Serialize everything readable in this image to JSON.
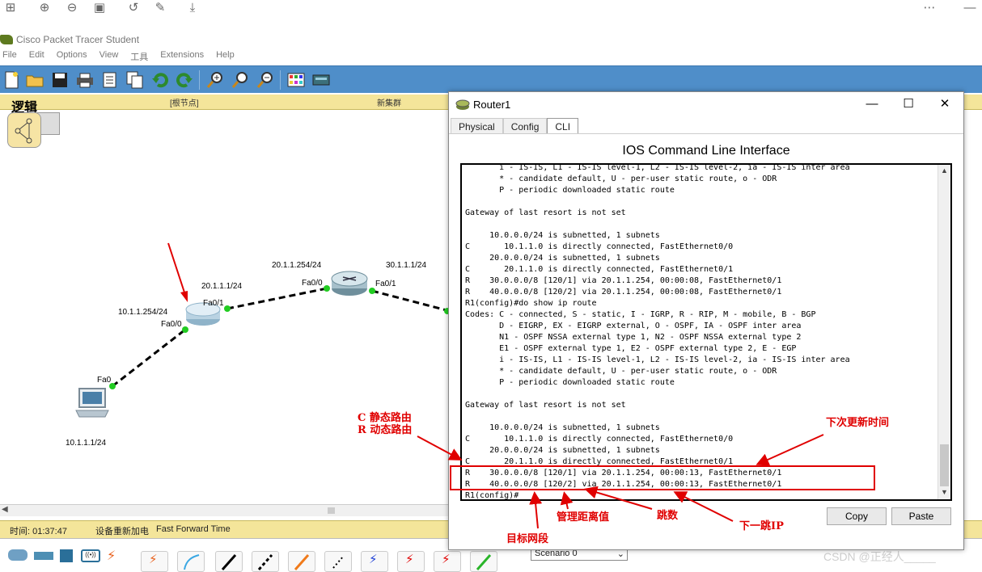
{
  "app": {
    "title": "Cisco Packet Tracer Student",
    "menu": [
      "File",
      "Edit",
      "Options",
      "View",
      "工具",
      "Extensions",
      "Help"
    ]
  },
  "logical": {
    "label": "逻辑",
    "root_node": "[根节点]",
    "new_cluster": "新集群"
  },
  "topology": {
    "pc_ip": "10.1.1.1/24",
    "pc_port": "Fa0",
    "r1_lan_ip": "10.1.1.254/24",
    "r1_fa00": "Fa0/0",
    "r1_fa01": "Fa0/1",
    "r1_wan_ip": "20.1.1.1/24",
    "r2_fa00_ip": "20.1.1.254/24",
    "r2_fa00": "Fa0/0",
    "r2_fa01": "Fa0/1",
    "r2_fa01_ip": "30.1.1.1/24"
  },
  "status_bar": {
    "time": "时间: 01:37:47",
    "power": "设备重新加电",
    "fast_forward": "Fast Forward Time"
  },
  "bottom": {
    "scenario": "Scenario 0",
    "watermark": "CSDN @正经人_____"
  },
  "window": {
    "title": "Router1",
    "tabs": [
      "Physical",
      "Config",
      "CLI"
    ],
    "active_tab": "CLI",
    "heading": "IOS Command Line Interface",
    "copy": "Copy",
    "paste": "Paste",
    "cli_lines": [
      "       i - IS-IS, L1 - IS-IS level-1, L2 - IS-IS level-2, ia - IS-IS inter area",
      "       * - candidate default, U - per-user static route, o - ODR",
      "       P - periodic downloaded static route",
      "",
      "Gateway of last resort is not set",
      "",
      "     10.0.0.0/24 is subnetted, 1 subnets",
      "C       10.1.1.0 is directly connected, FastEthernet0/0",
      "     20.0.0.0/24 is subnetted, 1 subnets",
      "C       20.1.1.0 is directly connected, FastEthernet0/1",
      "R    30.0.0.0/8 [120/1] via 20.1.1.254, 00:00:08, FastEthernet0/1",
      "R    40.0.0.0/8 [120/2] via 20.1.1.254, 00:00:08, FastEthernet0/1",
      "R1(config)#do show ip route",
      "Codes: C - connected, S - static, I - IGRP, R - RIP, M - mobile, B - BGP",
      "       D - EIGRP, EX - EIGRP external, O - OSPF, IA - OSPF inter area",
      "       N1 - OSPF NSSA external type 1, N2 - OSPF NSSA external type 2",
      "       E1 - OSPF external type 1, E2 - OSPF external type 2, E - EGP",
      "       i - IS-IS, L1 - IS-IS level-1, L2 - IS-IS level-2, ia - IS-IS inter area",
      "       * - candidate default, U - per-user static route, o - ODR",
      "       P - periodic downloaded static route",
      "",
      "Gateway of last resort is not set",
      "",
      "     10.0.0.0/24 is subnetted, 1 subnets",
      "C       10.1.1.0 is directly connected, FastEthernet0/0",
      "     20.0.0.0/24 is subnetted, 1 subnets",
      "C       20.1.1.0 is directly connected, FastEthernet0/1",
      "R    30.0.0.0/8 [120/1] via 20.1.1.254, 00:00:13, FastEthernet0/1",
      "R    40.0.0.0/8 [120/2] via 20.1.1.254, 00:00:13, FastEthernet0/1",
      "R1(config)#"
    ]
  },
  "annotations": {
    "c_static": "C 静态路由",
    "r_dynamic": "R 动态路由",
    "next_update": "下次更新时间",
    "admin_distance": "管理距离值",
    "hops": "跳数",
    "next_hop": "下一跳IP",
    "dest_network": "目标网段"
  },
  "colors": {
    "toolbar_blue": "#4f8ec9",
    "logic_yellow": "#f4e59a",
    "annotation_red": "#e00000",
    "link_green": "#22cc22"
  }
}
